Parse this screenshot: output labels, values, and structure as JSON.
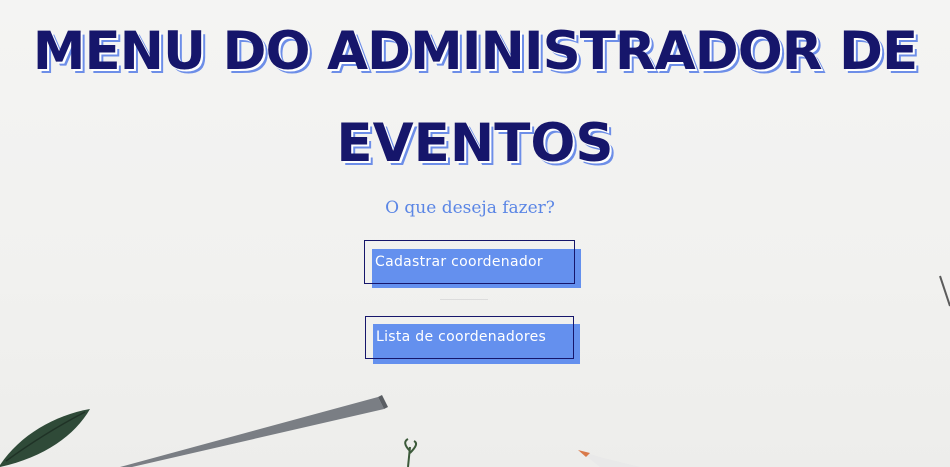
{
  "page": {
    "title_line1": "MENU DO ADMINISTRADOR DE",
    "title_line2": "EVENTOS",
    "prompt": "O que deseja fazer?"
  },
  "actions": {
    "register_coordinator_label": "Cadastrar coordenador",
    "coordinator_list_label": "Lista de coordenadores"
  },
  "colors": {
    "title": "#16166b",
    "title_shadow": "#6d8ee8",
    "accent": "#6490ee",
    "prompt": "#5b86e5",
    "button_border": "#16166b",
    "button_text": "#ffffff",
    "background": "#f3f3f2"
  }
}
